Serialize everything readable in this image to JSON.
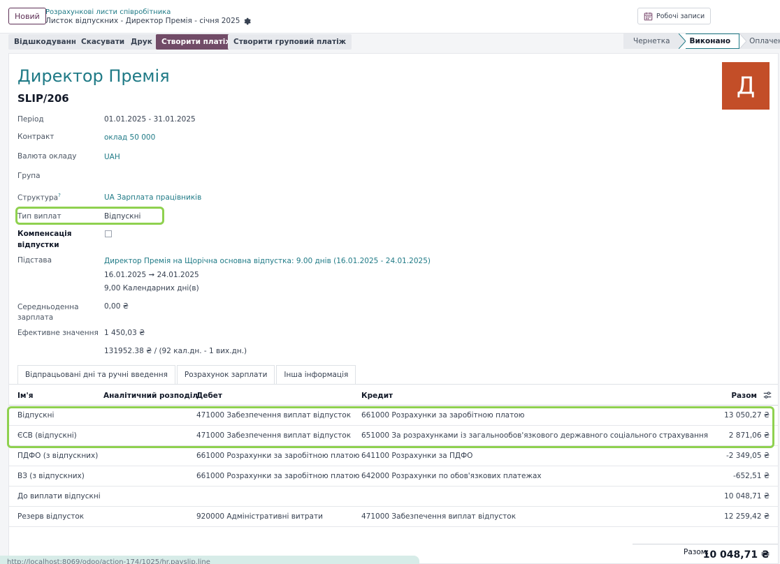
{
  "control_panel": {
    "new_label": "Новий",
    "breadcrumb_parent": "Розрахункові листи співробітника",
    "breadcrumb_current": "Листок відпускних - Директор Премія - січня 2025",
    "worklog_label": "Робочі записи"
  },
  "actions": {
    "refund": "Відшкодування",
    "cancel": "Скасувати",
    "print": "Друк",
    "create_payment": "Створити платіж",
    "create_group_payment": "Створити груповий платіж"
  },
  "statusbar": {
    "draft": "Чернетка",
    "done": "Виконано",
    "paid": "Оплачено"
  },
  "record": {
    "employee_name": "Директор Премія",
    "reference": "SLIP/206",
    "avatar_letter": "Д",
    "avatar_color": "#c34e28"
  },
  "fields": {
    "period_label": "Період",
    "period_value": "01.01.2025 - 31.01.2025",
    "contract_label": "Контракт",
    "contract_value": "оклад 50 000",
    "currency_label": "Валюта окладу",
    "currency_value": "UAH",
    "group_label": "Група",
    "structure_label": "Структура",
    "structure_help": "?",
    "structure_value": "UA Зарплата працівників",
    "payment_type_label": "Тип виплат",
    "payment_type_value": "Відпускні",
    "vacation_comp_label_1": "Компенсація",
    "vacation_comp_label_2": "відпустки",
    "basis_label": "Підстава",
    "basis_link": "Директор Премія на Щорічна основна відпустка: 9.00 днів (16.01.2025 - 24.01.2025)",
    "basis_dates": "16.01.2025 ➞ 24.01.2025",
    "basis_days": "9,00 Календарних дні(в)",
    "avg_salary_label_1": "Середньоденна",
    "avg_salary_label_2": "зарплата",
    "avg_salary_value": "0,00 ₴",
    "effective_label": "Ефективне значення",
    "effective_value": "1 450,03 ₴",
    "effective_calc": "131952.38 ₴ / (92 кал.дн. - 1 вих.дн.)"
  },
  "tabs": [
    {
      "label": "Відпрацьовані дні та ручні введення"
    },
    {
      "label": "Розрахунок зарплати"
    },
    {
      "label": "Інша інформація"
    }
  ],
  "table": {
    "headers": {
      "name": "Ім'я",
      "analytic": "Аналітичний розподіл",
      "debit": "Дебет",
      "credit": "Кредит",
      "total": "Разом"
    },
    "rows": [
      {
        "name": "Відпускні",
        "debit": "471000 Забезпечення виплат відпусток",
        "credit": "661000 Розрахунки за заробітною платою",
        "total": "13 050,27 ₴"
      },
      {
        "name": "ЄСВ (відпускні)",
        "debit": "471000 Забезпечення виплат відпусток",
        "credit": "651000 За розрахунками із загальнообов'язкового державного соціального страхування",
        "total": "2 871,06 ₴"
      },
      {
        "name": "ПДФО (з відпускних)",
        "debit": "661000 Розрахунки за заробітною платою",
        "credit": "641100 Розрахунки за ПДФО",
        "total": "-2 349,05 ₴"
      },
      {
        "name": "ВЗ (з відпускних)",
        "debit": "661000 Розрахунки за заробітною платою",
        "credit": "642000 Розрахунки по обов'язкових платежах",
        "total": "-652,51 ₴"
      },
      {
        "name": "До виплати відпускні",
        "debit": "",
        "credit": "",
        "total": "10 048,71 ₴"
      },
      {
        "name": "Резерв відпусток",
        "debit": "920000 Адміністративні витрати",
        "credit": "471000 Забезпечення виплат відпусток",
        "total": "12 259,42 ₴"
      }
    ],
    "total_label": "Разом:",
    "total_value": "10 048,71 ₴"
  },
  "tooltip_text": "http://localhost:8069/odoo/action-174/1025/hr.payslip.line"
}
